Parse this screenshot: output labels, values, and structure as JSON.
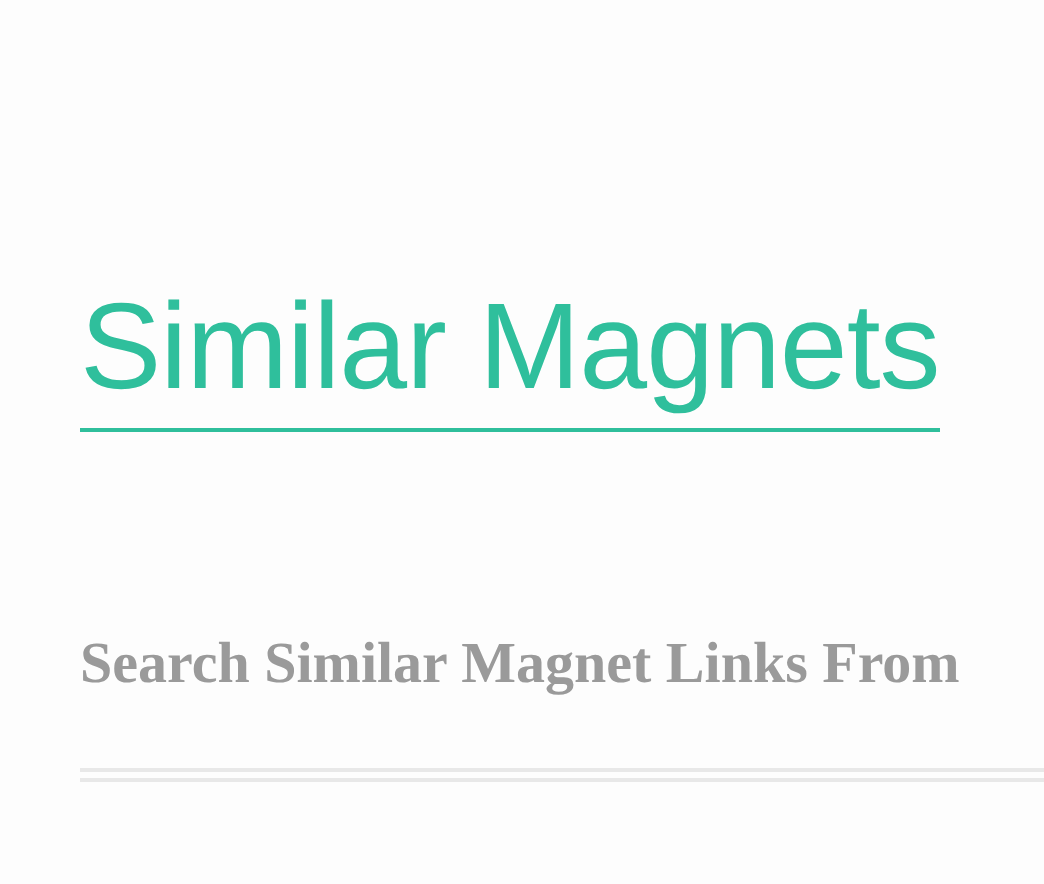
{
  "heading": "Similar Magnets",
  "subheading": "Search Similar Magnet Links From"
}
